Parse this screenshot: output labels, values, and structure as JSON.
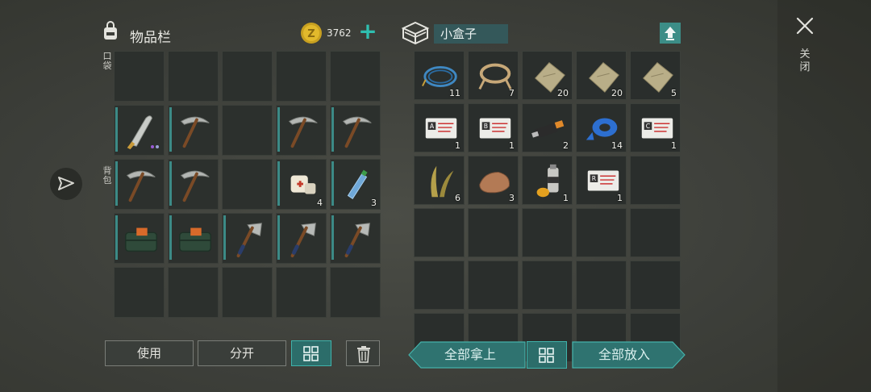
{
  "inventory": {
    "title": "物品栏",
    "coin_amount": "3762",
    "pocket_label": "口袋",
    "backpack_label": "背包",
    "buttons": {
      "use": "使用",
      "split": "分开"
    }
  },
  "container": {
    "name": "小盒子",
    "buttons": {
      "take_all": "全部拿上",
      "put_all": "全部放入"
    }
  },
  "close": {
    "label": "关闭"
  },
  "colors": {
    "accent": "#3c8a86",
    "button_teal": "#2c6d6a",
    "cell_bg": "#2c302d"
  },
  "inventory_slots": [
    {
      "item": "",
      "qty": ""
    },
    {
      "item": "",
      "qty": ""
    },
    {
      "item": "",
      "qty": ""
    },
    {
      "item": "",
      "qty": ""
    },
    {
      "item": "",
      "qty": ""
    },
    {
      "item": "machete",
      "qty": ""
    },
    {
      "item": "pickaxe",
      "qty": ""
    },
    {
      "item": "",
      "qty": ""
    },
    {
      "item": "pickaxe",
      "qty": ""
    },
    {
      "item": "pickaxe",
      "qty": ""
    },
    {
      "item": "pickaxe",
      "qty": ""
    },
    {
      "item": "pickaxe",
      "qty": ""
    },
    {
      "item": "",
      "qty": ""
    },
    {
      "item": "bandage",
      "qty": "4"
    },
    {
      "item": "water-bottle",
      "qty": "3"
    },
    {
      "item": "explosive-case",
      "qty": ""
    },
    {
      "item": "explosive-case",
      "qty": ""
    },
    {
      "item": "hatchet",
      "qty": ""
    },
    {
      "item": "hatchet",
      "qty": ""
    },
    {
      "item": "hatchet",
      "qty": ""
    },
    {
      "item": "",
      "qty": ""
    },
    {
      "item": "",
      "qty": ""
    },
    {
      "item": "",
      "qty": ""
    },
    {
      "item": "",
      "qty": ""
    },
    {
      "item": "",
      "qty": ""
    }
  ],
  "container_slots": [
    {
      "item": "wire",
      "qty": "11"
    },
    {
      "item": "rope",
      "qty": "7"
    },
    {
      "item": "cloth",
      "qty": "20"
    },
    {
      "item": "cloth",
      "qty": "20"
    },
    {
      "item": "cloth",
      "qty": "5"
    },
    {
      "item": "keycard-a",
      "qty": "1"
    },
    {
      "item": "keycard-b",
      "qty": "1"
    },
    {
      "item": "usb-drive",
      "qty": "2"
    },
    {
      "item": "duct-tape",
      "qty": "14"
    },
    {
      "item": "keycard-c",
      "qty": "1"
    },
    {
      "item": "plant-fiber",
      "qty": "6"
    },
    {
      "item": "ore-rock",
      "qty": "3"
    },
    {
      "item": "spray-can",
      "qty": "1"
    },
    {
      "item": "keycard-r",
      "qty": "1"
    },
    {
      "item": "",
      "qty": ""
    },
    {
      "item": "",
      "qty": ""
    },
    {
      "item": "",
      "qty": ""
    },
    {
      "item": "",
      "qty": ""
    },
    {
      "item": "",
      "qty": ""
    },
    {
      "item": "",
      "qty": ""
    },
    {
      "item": "",
      "qty": ""
    },
    {
      "item": "",
      "qty": ""
    },
    {
      "item": "",
      "qty": ""
    },
    {
      "item": "",
      "qty": ""
    },
    {
      "item": "",
      "qty": ""
    },
    {
      "item": "",
      "qty": ""
    },
    {
      "item": "",
      "qty": ""
    },
    {
      "item": "",
      "qty": ""
    },
    {
      "item": "",
      "qty": ""
    },
    {
      "item": "",
      "qty": ""
    }
  ]
}
